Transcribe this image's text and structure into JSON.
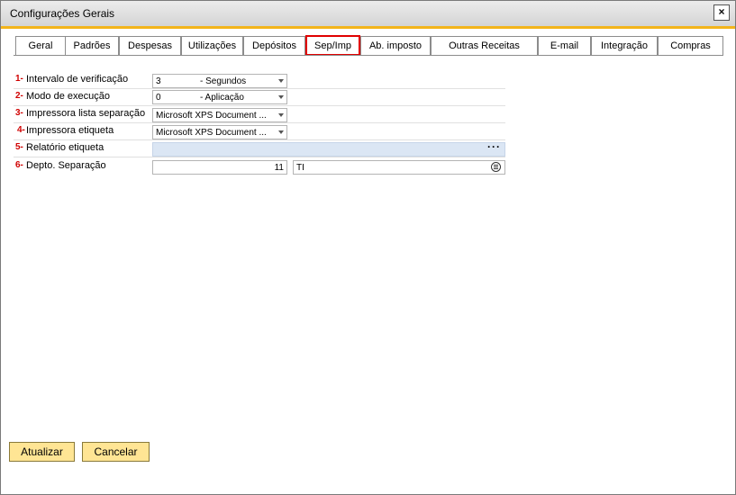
{
  "window": {
    "title": "Configurações Gerais",
    "close_label": "×"
  },
  "tabs": [
    {
      "label": "Geral"
    },
    {
      "label": "Padrões"
    },
    {
      "label": "Despesas"
    },
    {
      "label": "Utilizações"
    },
    {
      "label": "Depósitos"
    },
    {
      "label": "Sep/Imp",
      "active": true
    },
    {
      "label": "Ab. imposto"
    },
    {
      "label": "Outras Receitas"
    },
    {
      "label": "E-mail"
    },
    {
      "label": "Integração"
    },
    {
      "label": "Compras"
    }
  ],
  "rows": {
    "intervalo": {
      "num": "1-",
      "label": "Intervalo de verificação",
      "value": "3",
      "desc": "- Segundos"
    },
    "modo": {
      "num": "2-",
      "label": "Modo de execução",
      "value": "0",
      "desc": "- Aplicação"
    },
    "impressora_lista": {
      "num": "3-",
      "label": "Impressora lista separação",
      "value": "Microsoft XPS Document ..."
    },
    "impressora_etiqueta": {
      "num": "4-",
      "label": "Impressora etiqueta",
      "value": "Microsoft XPS Document ..."
    },
    "relatorio": {
      "num": "5-",
      "label": "Relatório etiqueta",
      "value": "",
      "dots": "···"
    },
    "depto": {
      "num": "6-",
      "label": "Depto. Separação",
      "code": "11",
      "name": "TI"
    }
  },
  "buttons": {
    "update": "Atualizar",
    "cancel": "Cancelar"
  },
  "colors": {
    "accent": "#f3b41b",
    "button": "#ffe594",
    "active_tab_border": "#e00000",
    "number": "#d00000"
  },
  "icons": {
    "close": "close-icon",
    "dropdown": "chevron-down-icon",
    "browse": "ellipsis-icon",
    "list": "list-icon"
  }
}
